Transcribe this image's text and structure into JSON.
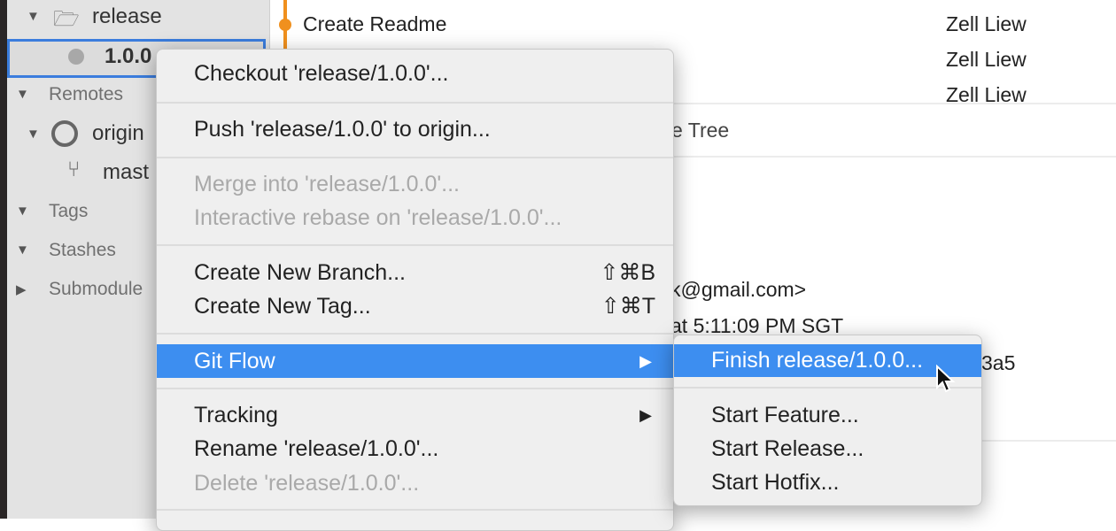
{
  "sidebar": {
    "folder": "release",
    "branch": "1.0.0",
    "remotes": "Remotes",
    "origin": "origin",
    "master": "mast",
    "tags": "Tags",
    "stashes": "Stashes",
    "submodules": "Submodule"
  },
  "commits": [
    {
      "message": "Create Readme",
      "author": "Zell Liew"
    },
    {
      "message": "",
      "author": "Zell Liew"
    },
    {
      "message": "",
      "author": "Zell Liew"
    }
  ],
  "details": {
    "subject_fragment": "e Tree",
    "email_fragment": "k@gmail.com>",
    "date_fragment": "at 5:11:09 PM SGT",
    "hash_fragment": "3a5"
  },
  "context_menu": {
    "checkout": "Checkout 'release/1.0.0'...",
    "push": "Push 'release/1.0.0' to origin...",
    "merge": "Merge into 'release/1.0.0'...",
    "rebase": "Interactive rebase on 'release/1.0.0'...",
    "new_branch": "Create New Branch...",
    "new_branch_shortcut": "⇧⌘B",
    "new_tag": "Create New Tag...",
    "new_tag_shortcut": "⇧⌘T",
    "git_flow": "Git Flow",
    "tracking": "Tracking",
    "rename": "Rename 'release/1.0.0'...",
    "delete": "Delete 'release/1.0.0'..."
  },
  "submenu": {
    "finish": "Finish release/1.0.0...",
    "start_feature": "Start Feature...",
    "start_release": "Start Release...",
    "start_hotfix": "Start Hotfix..."
  },
  "colors": {
    "highlight": "#3d8ef0",
    "selection_border": "#3b7ddd",
    "graph": "#f0901e"
  }
}
